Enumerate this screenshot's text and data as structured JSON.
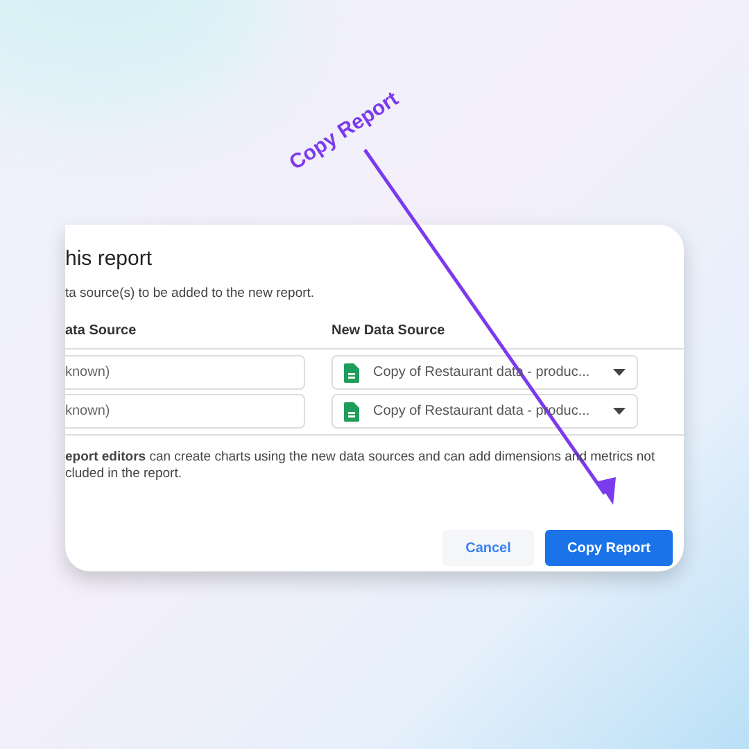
{
  "annotation": {
    "label": "Copy Report"
  },
  "dialog": {
    "title": "his report",
    "subtitle": "ta source(s) to be added to the new report.",
    "columns": [
      "ata Source",
      "New Data Source"
    ],
    "rows": [
      {
        "current": "known)",
        "new_source": "Copy of Restaurant data - produc..."
      },
      {
        "current": "known)",
        "new_source": "Copy of Restaurant data - produc..."
      }
    ],
    "note": "**eport editors** can create charts using the new data sources and can add dimensions and metrics not cluded in the report.",
    "buttons": [
      {
        "label": "Cancel",
        "kind": "secondary"
      },
      {
        "label": "Copy Report",
        "kind": "primary"
      }
    ]
  }
}
